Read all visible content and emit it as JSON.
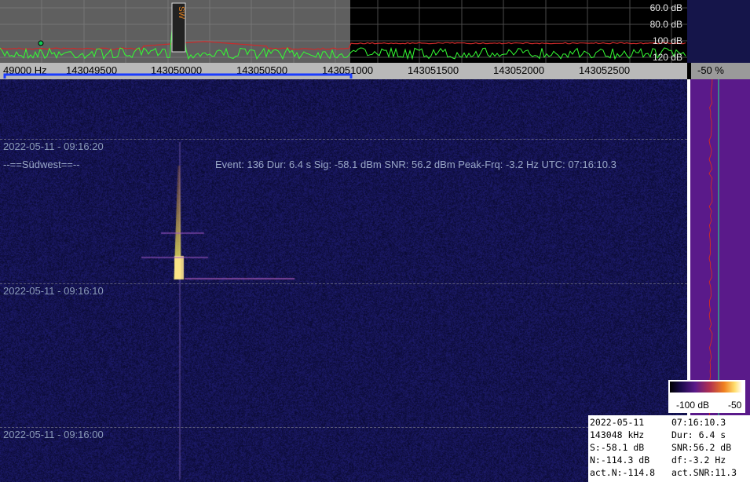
{
  "spectrum": {
    "db_labels": [
      "60.0 dB",
      "80.0 dB",
      "100 dB",
      "120 dB"
    ],
    "marker_text": "SW"
  },
  "ruler": {
    "freq_labels": [
      "49000 Hz",
      "143049500",
      "143050000",
      "143050500",
      "143051000",
      "143051500",
      "143052000",
      "143052500"
    ],
    "percent": "-50 %"
  },
  "waterfall": {
    "time_labels": [
      "2022-05-11 - 09:16:20",
      "2022-05-11 - 09:16:10",
      "2022-05-11 - 09:16:00"
    ],
    "station": "--==Südwest==--",
    "event_line": "Event: 136   Dur: 6.4 s   Sig: -58.1 dBm   SNR: 56.2 dBm   Peak-Frq: -3.2 Hz   UTC: 07:16:10.3"
  },
  "colorbar": {
    "min_label": "-100 dB",
    "max_label": "-50"
  },
  "info": {
    "rows": [
      [
        "2022-05-11",
        "07:16:10.3"
      ],
      [
        "143048 kHz",
        "Dur: 6.4 s"
      ],
      [
        "S:-58.1 dB",
        "SNR:56.2 dB"
      ],
      [
        "N:-114.3 dB",
        "df:-3.2 Hz"
      ],
      [
        "act.N:-114.8",
        "act.SNR:11.3"
      ]
    ]
  },
  "colors": {
    "trace_green": "#33ff33",
    "trace_red": "#cc2a2a",
    "selection_blue": "#1a3cff",
    "waterfall_bg": "#15154a"
  }
}
